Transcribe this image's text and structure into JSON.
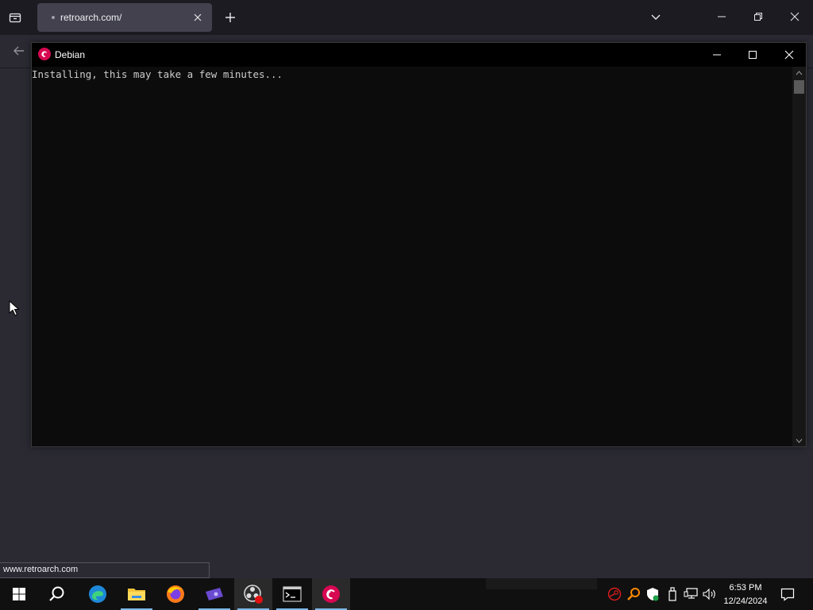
{
  "browser": {
    "tab_title": "retroarch.com/",
    "status_url": "www.retroarch.com"
  },
  "console": {
    "title": "Debian",
    "output": "Installing, this may take a few minutes..."
  },
  "taskbar": {
    "items": [
      "start-icon",
      "search-icon",
      "edge-icon",
      "file-explorer-icon",
      "firefox-icon",
      "game-launcher-icon",
      "obs-icon",
      "terminal-icon",
      "debian-icon"
    ],
    "active_app": "debian-icon"
  },
  "system_tray": {
    "time": "6:53 PM",
    "date": "12/24/2024"
  },
  "colors": {
    "debian_red": "#d70751",
    "console_bg": "#0c0c0c",
    "taskbar_bg": "#101010",
    "browser_bg": "#2b2a33"
  }
}
